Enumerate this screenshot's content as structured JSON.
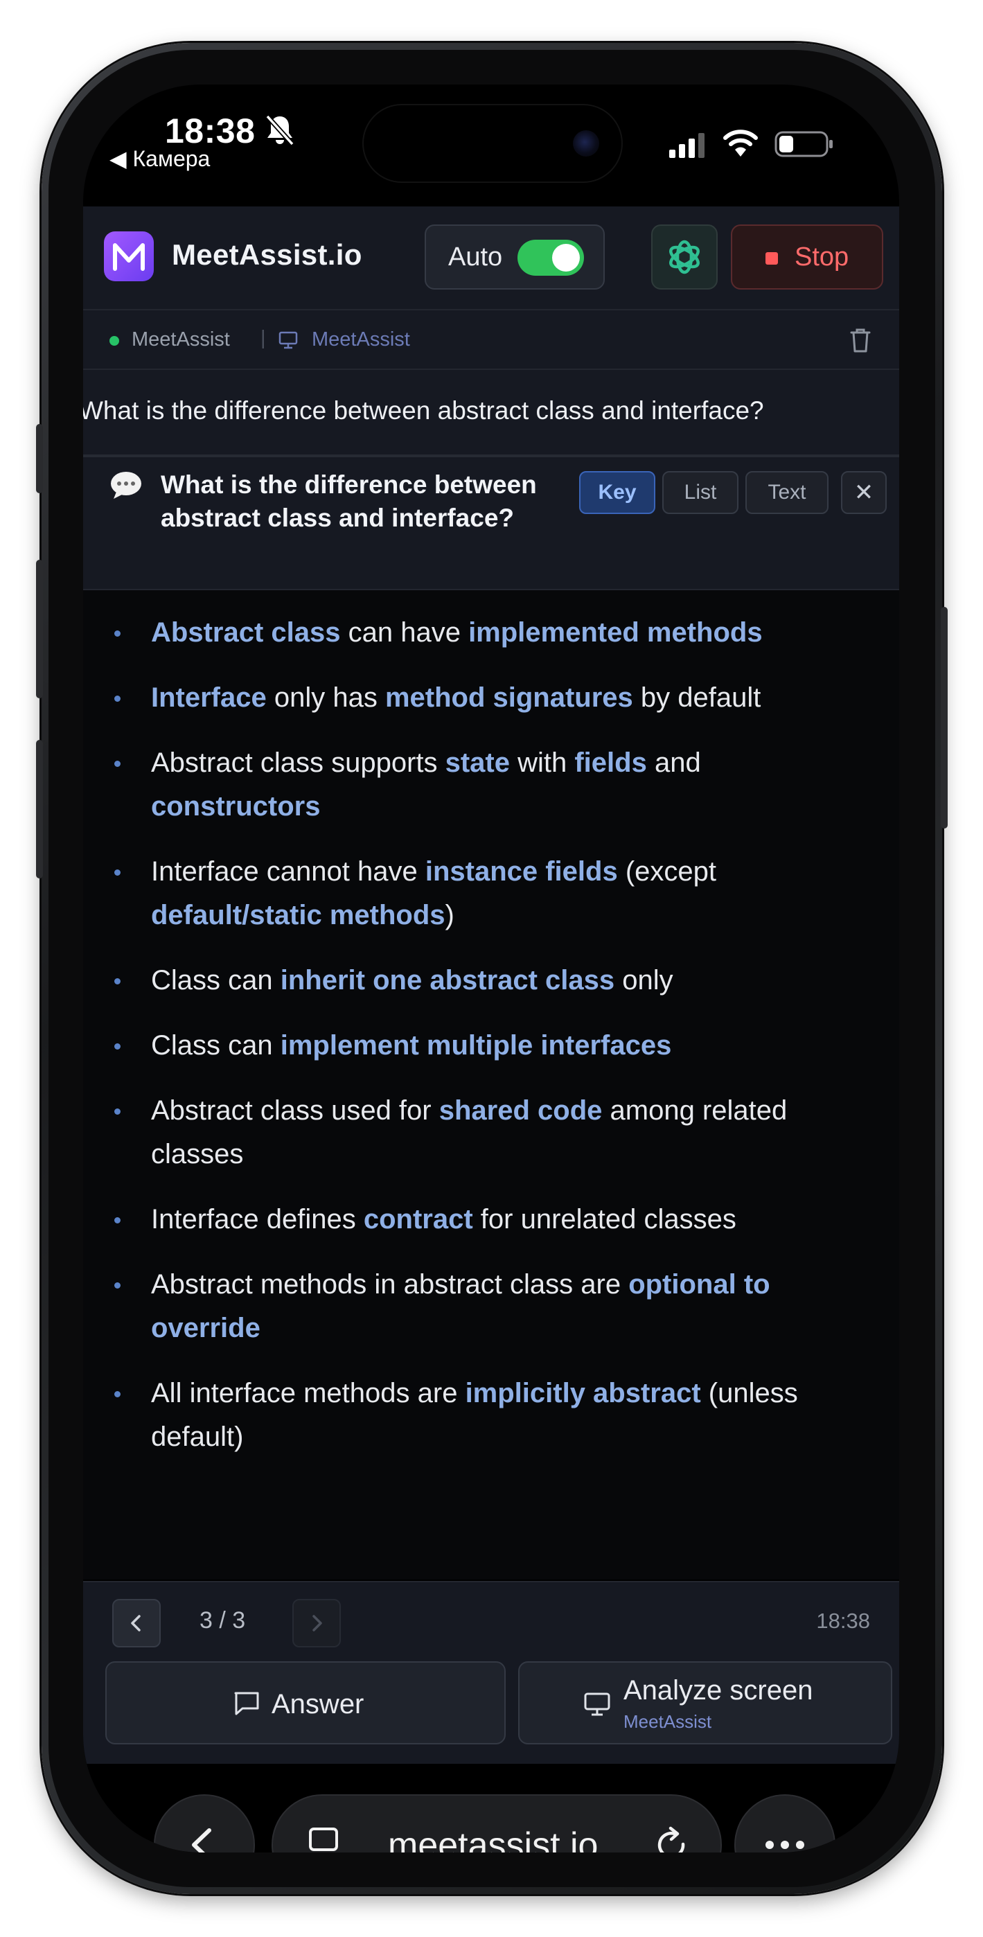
{
  "status_bar": {
    "time": "18:38",
    "back_label": "◀ Камера"
  },
  "header": {
    "brand": "MeetAssist.io",
    "auto_label": "Auto",
    "auto_enabled": true,
    "stop_label": "Stop",
    "colors": {
      "accent_green": "#30c35a",
      "stop_red": "#ff6b6b",
      "logo_purple": "#a259ff"
    }
  },
  "source_row": {
    "audio_source": "MeetAssist",
    "separator": "|",
    "screen_source": "MeetAssist"
  },
  "transcript": {
    "text": "What is the difference between abstract class and interface?"
  },
  "question": {
    "title": "What is the difference between abstract class and interface?",
    "modes": [
      {
        "label": "Key",
        "active": true
      },
      {
        "label": "List",
        "active": false
      },
      {
        "label": "Text",
        "active": false
      }
    ],
    "close_label": "✕"
  },
  "answer_points": [
    [
      {
        "t": "Abstract class",
        "hl": true
      },
      {
        "t": " can have "
      },
      {
        "t": "implemented methods",
        "hl": true
      }
    ],
    [
      {
        "t": "Interface",
        "hl": true
      },
      {
        "t": " only has "
      },
      {
        "t": "method signatures",
        "hl": true
      },
      {
        "t": " by default"
      }
    ],
    [
      {
        "t": "Abstract class supports "
      },
      {
        "t": "state",
        "hl": true
      },
      {
        "t": " with "
      },
      {
        "t": "fields",
        "hl": true
      },
      {
        "t": " and "
      },
      {
        "t": "constructors",
        "hl": true
      }
    ],
    [
      {
        "t": "Interface cannot have "
      },
      {
        "t": "instance fields",
        "hl": true
      },
      {
        "t": " (except "
      },
      {
        "t": "default/static methods",
        "hl": true
      },
      {
        "t": ")"
      }
    ],
    [
      {
        "t": "Class can "
      },
      {
        "t": "inherit one abstract class",
        "hl": true
      },
      {
        "t": " only"
      }
    ],
    [
      {
        "t": "Class can "
      },
      {
        "t": "implement multiple interfaces",
        "hl": true
      }
    ],
    [
      {
        "t": "Abstract class used for "
      },
      {
        "t": "shared code",
        "hl": true
      },
      {
        "t": " among related classes"
      }
    ],
    [
      {
        "t": "Interface defines "
      },
      {
        "t": "contract",
        "hl": true
      },
      {
        "t": " for unrelated classes"
      }
    ],
    [
      {
        "t": "Abstract methods in abstract class are "
      },
      {
        "t": "optional to override",
        "hl": true
      }
    ],
    [
      {
        "t": "All interface methods are "
      },
      {
        "t": "implicitly abstract",
        "hl": true
      },
      {
        "t": " (unless default)"
      }
    ]
  ],
  "pager": {
    "count": "3 / 3",
    "time": "18:38"
  },
  "actions": {
    "answer_label": "Answer",
    "analyze_label": "Analyze screen",
    "analyze_sub": "MeetAssist"
  },
  "browser": {
    "url": "meetassist.io"
  }
}
